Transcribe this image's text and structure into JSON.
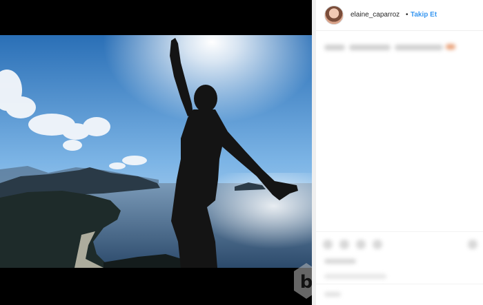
{
  "post": {
    "username": "elaine_caparroz",
    "separator": "•",
    "follow_label": "Takip Et"
  },
  "colors": {
    "follow": "#3897f0",
    "media_background": "#000000",
    "side_background": "#ffffff"
  },
  "icons": {
    "watermark": "b-logo-watermark"
  }
}
